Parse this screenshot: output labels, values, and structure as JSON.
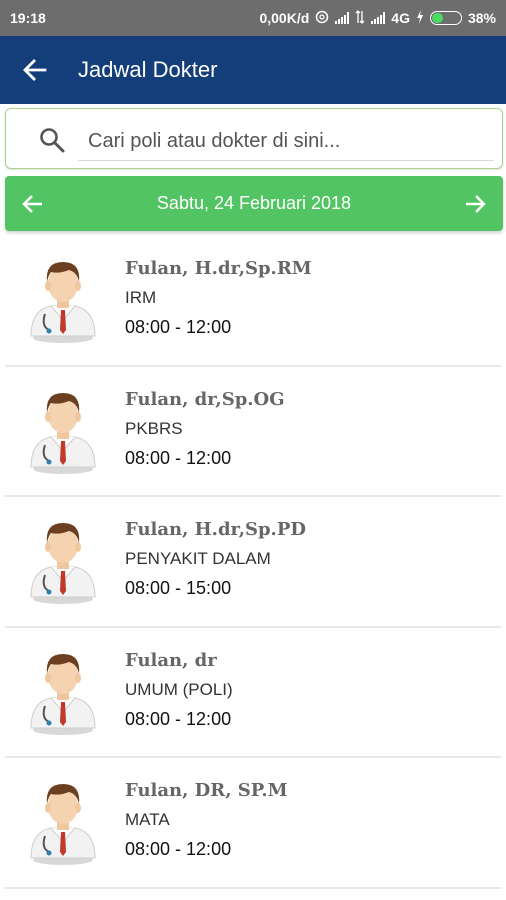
{
  "status_bar": {
    "time": "19:18",
    "network_speed": "0,00K/d",
    "network_type": "4G",
    "battery": "38%",
    "battery_level": 0.38,
    "battery_color": "#4cd964"
  },
  "app_bar": {
    "title": "Jadwal Dokter",
    "back_icon": "arrow-left-icon",
    "color": "#133e7a"
  },
  "search": {
    "placeholder": "Cari poli atau dokter di sini...",
    "value": "",
    "icon": "search-icon"
  },
  "date_bar": {
    "date": "Sabtu, 24 Februari 2018",
    "prev_icon": "arrow-left-icon",
    "next_icon": "arrow-right-icon",
    "color": "#52c463"
  },
  "doctors": [
    {
      "name": "Fulan, H.dr,Sp.RM",
      "poli": "IRM",
      "time": "08:00 - 12:00"
    },
    {
      "name": "Fulan, dr,Sp.OG",
      "poli": "PKBRS",
      "time": "08:00 - 12:00"
    },
    {
      "name": "Fulan, H.dr,Sp.PD",
      "poli": "PENYAKIT DALAM",
      "time": "08:00 - 15:00"
    },
    {
      "name": "Fulan, dr",
      "poli": "UMUM (POLI)",
      "time": "08:00 - 12:00"
    },
    {
      "name": "Fulan, DR, SP.M",
      "poli": "MATA",
      "time": "08:00 - 12:00"
    }
  ]
}
